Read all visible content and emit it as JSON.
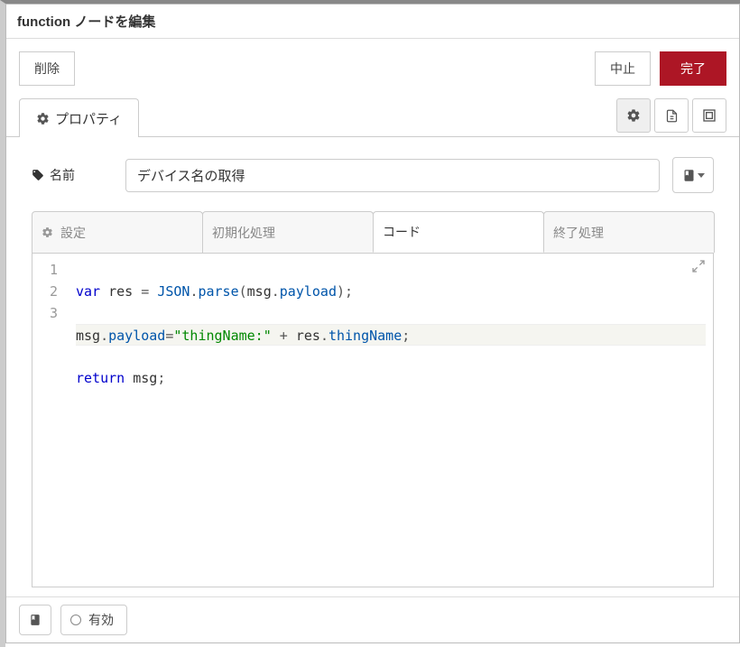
{
  "header": {
    "title": "function ノードを編集"
  },
  "buttons": {
    "delete_label": "削除",
    "cancel_label": "中止",
    "done_label": "完了"
  },
  "main_tab": {
    "label": "プロパティ"
  },
  "name_field": {
    "label": "名前",
    "value": "デバイス名の取得"
  },
  "sub_tabs": [
    {
      "label": "設定",
      "has_gear": true
    },
    {
      "label": "初期化処理",
      "has_gear": false
    },
    {
      "label": "コード",
      "has_gear": false,
      "active": true
    },
    {
      "label": "終了処理",
      "has_gear": false
    }
  ],
  "editor": {
    "line_numbers": [
      "1",
      "2",
      "3"
    ],
    "lines_plain": [
      "var res = JSON.parse(msg.payload);",
      "msg.payload=\"thingName:\" + res.thingName;",
      "return msg;"
    ]
  },
  "footer": {
    "enabled_label": "有効"
  }
}
